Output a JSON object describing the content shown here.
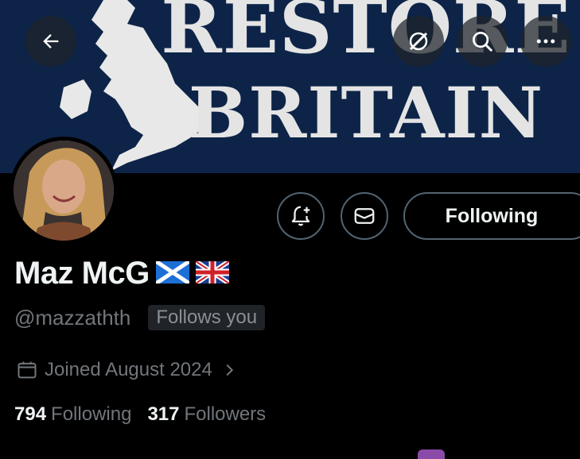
{
  "banner": {
    "line1": "RESTORE",
    "line2": "BRITAIN"
  },
  "nav": {
    "back_icon": "arrow-left-icon",
    "grok_icon": "grok-icon",
    "search_icon": "search-icon",
    "more_icon": "more-horizontal-icon"
  },
  "actions": {
    "notify_icon": "bell-plus-icon",
    "message_icon": "envelope-icon",
    "following_label": "Following"
  },
  "profile": {
    "display_name": "Maz McG",
    "flags": [
      "scotland-flag-icon",
      "union-jack-flag-icon"
    ],
    "handle": "@mazzathth",
    "follows_you": "Follows you",
    "joined": "Joined August 2024",
    "following_count": "794",
    "following_label": "Following",
    "followers_count": "317",
    "followers_label": "Followers"
  },
  "colors": {
    "background": "#000000",
    "banner": "#0d2448",
    "muted_text": "#71767b",
    "border": "#536471"
  }
}
